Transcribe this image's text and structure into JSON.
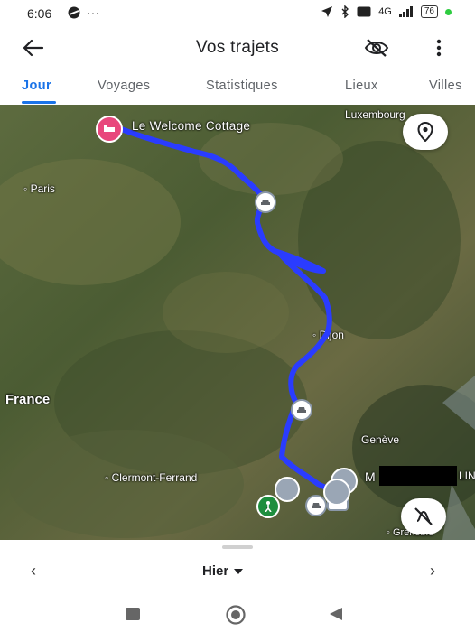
{
  "status_bar": {
    "time": "6:06",
    "dots": "···",
    "network": "4G",
    "battery": "76"
  },
  "app_bar": {
    "title": "Vos trajets"
  },
  "tabs": [
    {
      "label": "Jour",
      "active": true
    },
    {
      "label": "Voyages",
      "active": false
    },
    {
      "label": "Statistiques",
      "active": false
    },
    {
      "label": "Lieux",
      "active": false
    },
    {
      "label": "Villes",
      "active": false
    }
  ],
  "map": {
    "labels": {
      "luxembourg": "Luxembourg",
      "paris": "Paris",
      "dijon": "Dijon",
      "france": "France",
      "geneve": "Genève",
      "clermont": "Clermont-Ferrand",
      "grenoble": "Grenoble",
      "partial_m": "M",
      "partial_lin": "LIN"
    },
    "poi": {
      "name": "Le Welcome Cottage"
    },
    "route_color": "#2a3cff",
    "poi_color": "#e8477c",
    "destination_color": "#1e8e3e"
  },
  "bottom_sheet": {
    "day_label": "Hier",
    "prev_icon": "‹",
    "next_icon": "›"
  },
  "icons": [
    "back-arrow-icon",
    "location-off-icon",
    "more-vert-icon",
    "place-icon",
    "hide-route-icon",
    "car-icon",
    "hotel-icon"
  ]
}
